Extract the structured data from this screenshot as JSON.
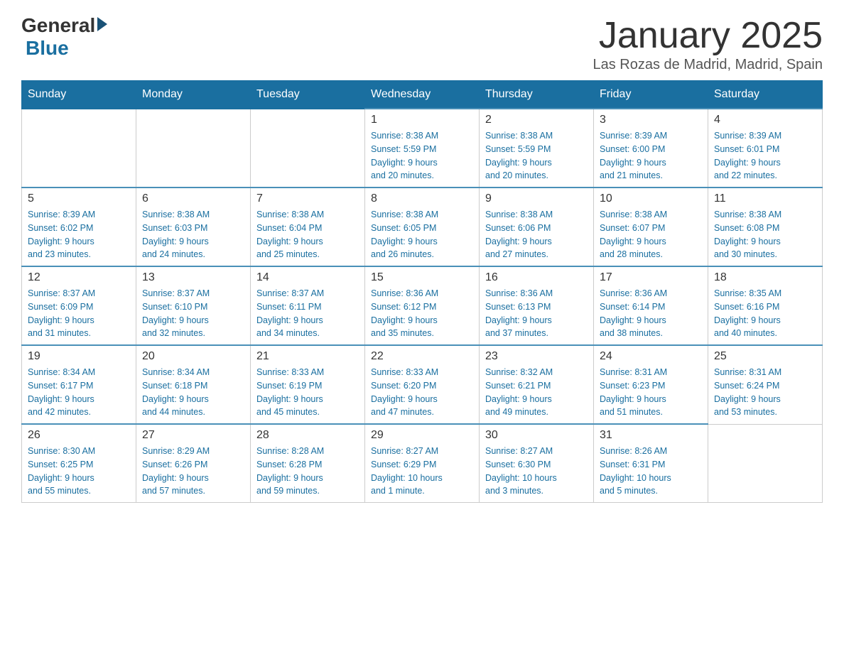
{
  "logo": {
    "general": "General",
    "blue": "Blue"
  },
  "title": "January 2025",
  "location": "Las Rozas de Madrid, Madrid, Spain",
  "weekdays": [
    "Sunday",
    "Monday",
    "Tuesday",
    "Wednesday",
    "Thursday",
    "Friday",
    "Saturday"
  ],
  "weeks": [
    [
      {
        "day": "",
        "info": ""
      },
      {
        "day": "",
        "info": ""
      },
      {
        "day": "",
        "info": ""
      },
      {
        "day": "1",
        "info": "Sunrise: 8:38 AM\nSunset: 5:59 PM\nDaylight: 9 hours\nand 20 minutes."
      },
      {
        "day": "2",
        "info": "Sunrise: 8:38 AM\nSunset: 5:59 PM\nDaylight: 9 hours\nand 20 minutes."
      },
      {
        "day": "3",
        "info": "Sunrise: 8:39 AM\nSunset: 6:00 PM\nDaylight: 9 hours\nand 21 minutes."
      },
      {
        "day": "4",
        "info": "Sunrise: 8:39 AM\nSunset: 6:01 PM\nDaylight: 9 hours\nand 22 minutes."
      }
    ],
    [
      {
        "day": "5",
        "info": "Sunrise: 8:39 AM\nSunset: 6:02 PM\nDaylight: 9 hours\nand 23 minutes."
      },
      {
        "day": "6",
        "info": "Sunrise: 8:38 AM\nSunset: 6:03 PM\nDaylight: 9 hours\nand 24 minutes."
      },
      {
        "day": "7",
        "info": "Sunrise: 8:38 AM\nSunset: 6:04 PM\nDaylight: 9 hours\nand 25 minutes."
      },
      {
        "day": "8",
        "info": "Sunrise: 8:38 AM\nSunset: 6:05 PM\nDaylight: 9 hours\nand 26 minutes."
      },
      {
        "day": "9",
        "info": "Sunrise: 8:38 AM\nSunset: 6:06 PM\nDaylight: 9 hours\nand 27 minutes."
      },
      {
        "day": "10",
        "info": "Sunrise: 8:38 AM\nSunset: 6:07 PM\nDaylight: 9 hours\nand 28 minutes."
      },
      {
        "day": "11",
        "info": "Sunrise: 8:38 AM\nSunset: 6:08 PM\nDaylight: 9 hours\nand 30 minutes."
      }
    ],
    [
      {
        "day": "12",
        "info": "Sunrise: 8:37 AM\nSunset: 6:09 PM\nDaylight: 9 hours\nand 31 minutes."
      },
      {
        "day": "13",
        "info": "Sunrise: 8:37 AM\nSunset: 6:10 PM\nDaylight: 9 hours\nand 32 minutes."
      },
      {
        "day": "14",
        "info": "Sunrise: 8:37 AM\nSunset: 6:11 PM\nDaylight: 9 hours\nand 34 minutes."
      },
      {
        "day": "15",
        "info": "Sunrise: 8:36 AM\nSunset: 6:12 PM\nDaylight: 9 hours\nand 35 minutes."
      },
      {
        "day": "16",
        "info": "Sunrise: 8:36 AM\nSunset: 6:13 PM\nDaylight: 9 hours\nand 37 minutes."
      },
      {
        "day": "17",
        "info": "Sunrise: 8:36 AM\nSunset: 6:14 PM\nDaylight: 9 hours\nand 38 minutes."
      },
      {
        "day": "18",
        "info": "Sunrise: 8:35 AM\nSunset: 6:16 PM\nDaylight: 9 hours\nand 40 minutes."
      }
    ],
    [
      {
        "day": "19",
        "info": "Sunrise: 8:34 AM\nSunset: 6:17 PM\nDaylight: 9 hours\nand 42 minutes."
      },
      {
        "day": "20",
        "info": "Sunrise: 8:34 AM\nSunset: 6:18 PM\nDaylight: 9 hours\nand 44 minutes."
      },
      {
        "day": "21",
        "info": "Sunrise: 8:33 AM\nSunset: 6:19 PM\nDaylight: 9 hours\nand 45 minutes."
      },
      {
        "day": "22",
        "info": "Sunrise: 8:33 AM\nSunset: 6:20 PM\nDaylight: 9 hours\nand 47 minutes."
      },
      {
        "day": "23",
        "info": "Sunrise: 8:32 AM\nSunset: 6:21 PM\nDaylight: 9 hours\nand 49 minutes."
      },
      {
        "day": "24",
        "info": "Sunrise: 8:31 AM\nSunset: 6:23 PM\nDaylight: 9 hours\nand 51 minutes."
      },
      {
        "day": "25",
        "info": "Sunrise: 8:31 AM\nSunset: 6:24 PM\nDaylight: 9 hours\nand 53 minutes."
      }
    ],
    [
      {
        "day": "26",
        "info": "Sunrise: 8:30 AM\nSunset: 6:25 PM\nDaylight: 9 hours\nand 55 minutes."
      },
      {
        "day": "27",
        "info": "Sunrise: 8:29 AM\nSunset: 6:26 PM\nDaylight: 9 hours\nand 57 minutes."
      },
      {
        "day": "28",
        "info": "Sunrise: 8:28 AM\nSunset: 6:28 PM\nDaylight: 9 hours\nand 59 minutes."
      },
      {
        "day": "29",
        "info": "Sunrise: 8:27 AM\nSunset: 6:29 PM\nDaylight: 10 hours\nand 1 minute."
      },
      {
        "day": "30",
        "info": "Sunrise: 8:27 AM\nSunset: 6:30 PM\nDaylight: 10 hours\nand 3 minutes."
      },
      {
        "day": "31",
        "info": "Sunrise: 8:26 AM\nSunset: 6:31 PM\nDaylight: 10 hours\nand 5 minutes."
      },
      {
        "day": "",
        "info": ""
      }
    ]
  ]
}
